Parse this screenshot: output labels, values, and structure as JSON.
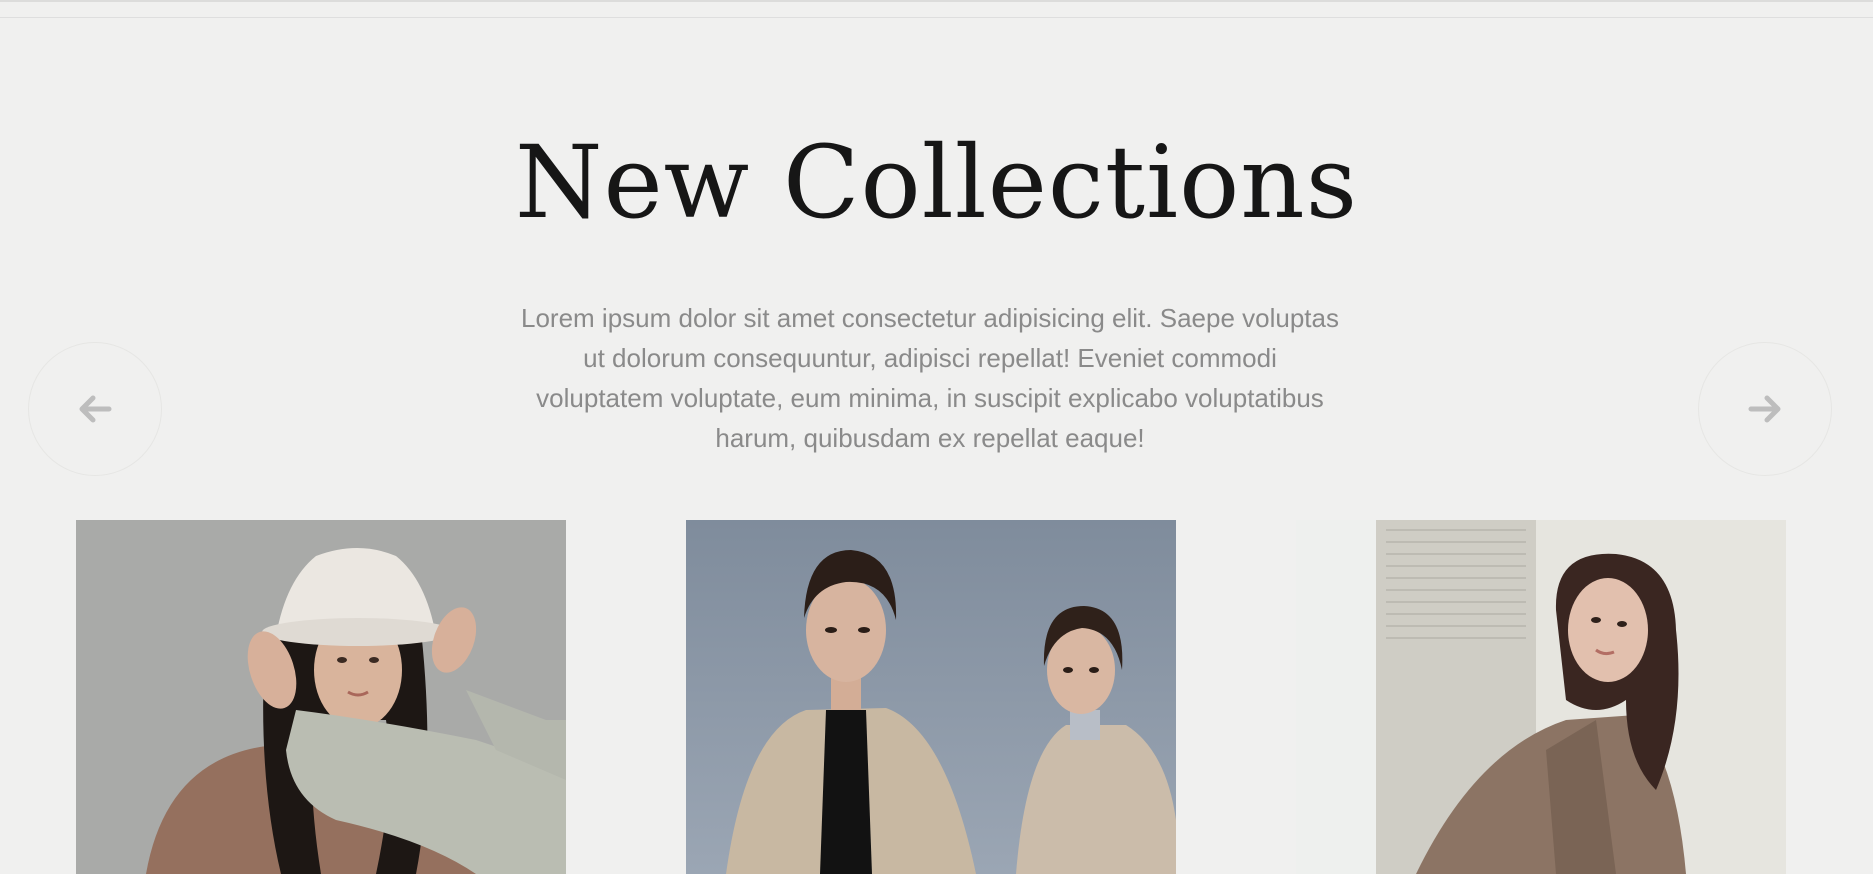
{
  "section": {
    "title": "New Collections",
    "description": "Lorem ipsum dolor sit amet consectetur adipisicing elit. Saepe voluptas ut dolorum consequuntur, adipisci repellat! Eveniet commodi voluptatem voluptate, eum minima, in suscipit explicabo voluptatibus harum, quibusdam ex repellat eaque!"
  },
  "navigation": {
    "prev_icon": "arrow-left-icon",
    "next_icon": "arrow-right-icon"
  },
  "products": [
    {
      "image": "model-white-bucket-hat-brown-top"
    },
    {
      "image": "two-models-beige-trench-coats"
    },
    {
      "image": "model-brown-plaid-blazer"
    }
  ],
  "colors": {
    "background": "#f0f0ef",
    "title": "#161616",
    "description": "#8a8a8a",
    "icon": "#bdbdbd"
  }
}
